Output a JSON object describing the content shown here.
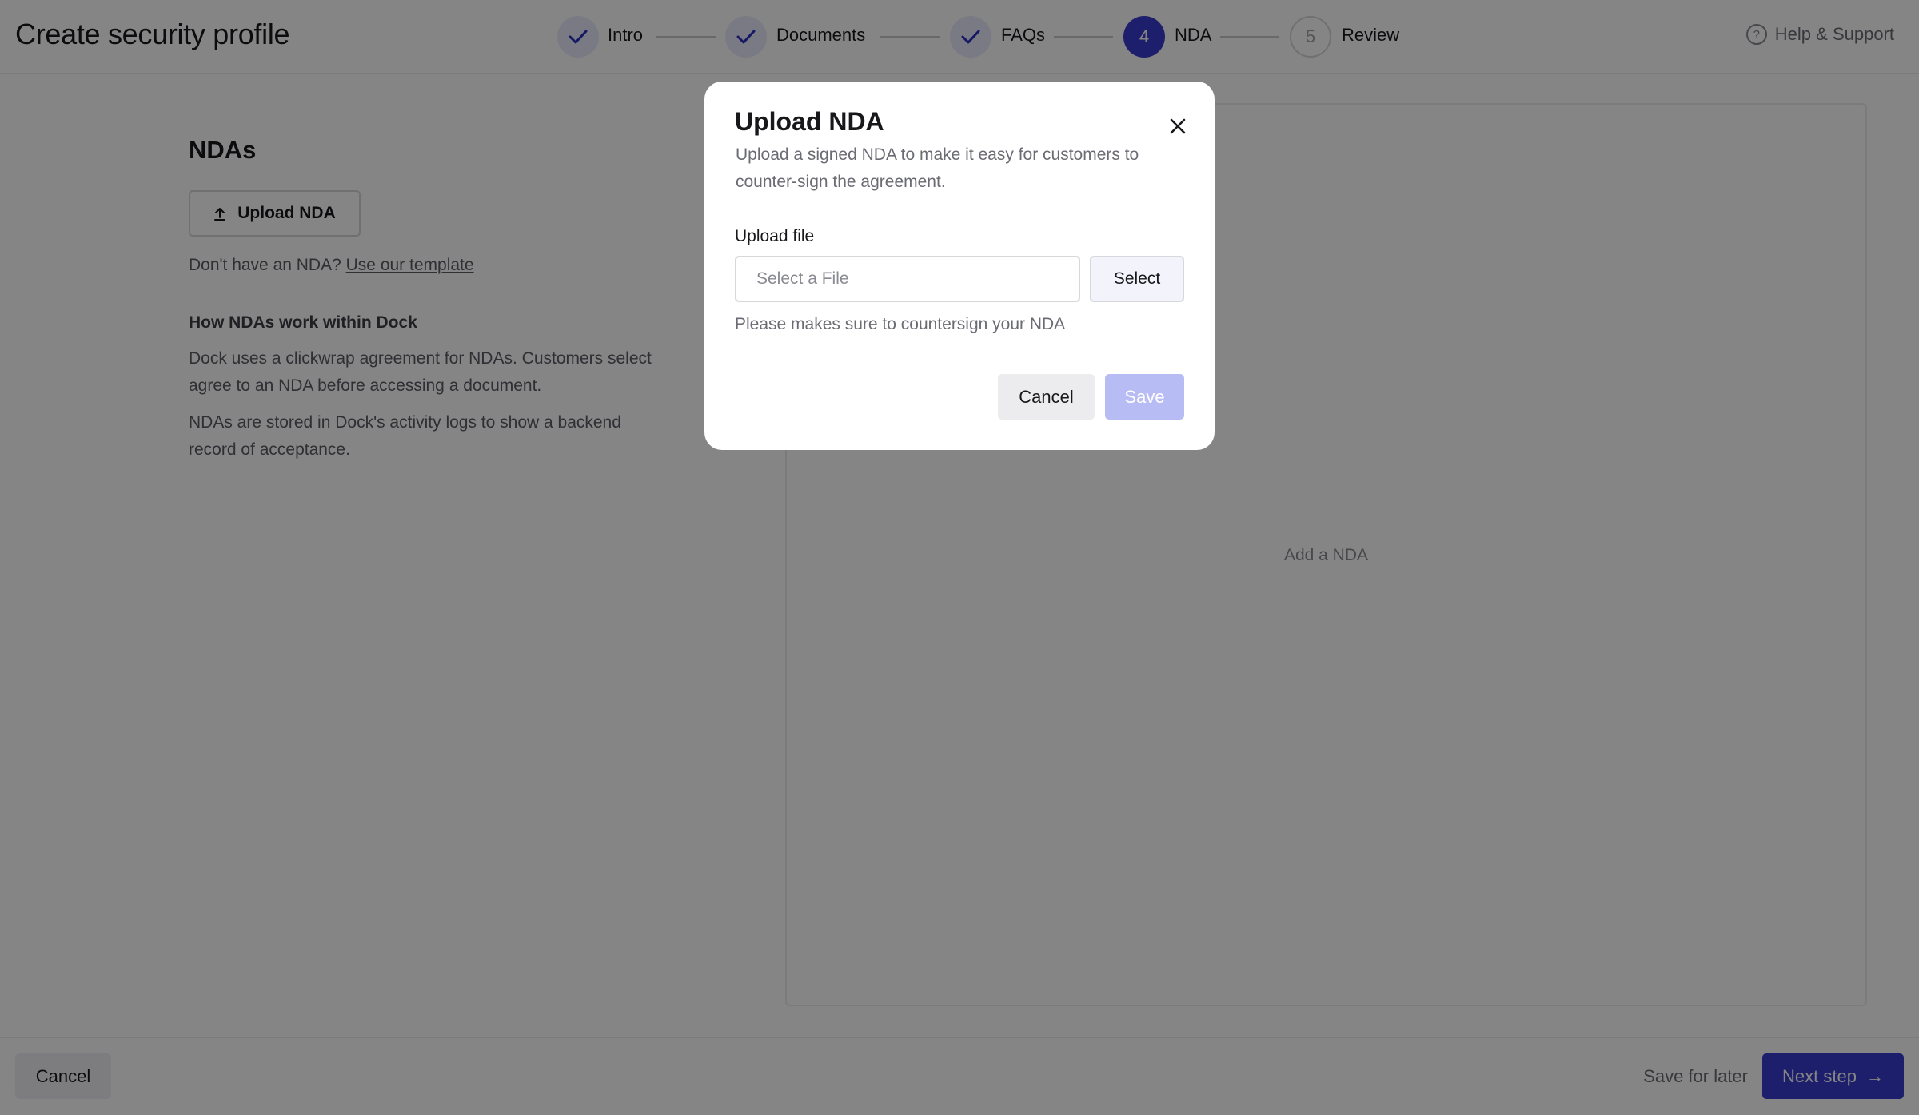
{
  "header": {
    "title": "Create security profile",
    "steps": [
      {
        "number": "",
        "label": "Intro",
        "state": "done"
      },
      {
        "number": "",
        "label": "Documents",
        "state": "done"
      },
      {
        "number": "",
        "label": "FAQs",
        "state": "done"
      },
      {
        "number": "4",
        "label": "NDA",
        "state": "current"
      },
      {
        "number": "5",
        "label": "Review",
        "state": "todo"
      }
    ],
    "help_label": "Help & Support",
    "help_glyph": "?"
  },
  "left": {
    "title": "NDAs",
    "upload_label": "Upload NDA",
    "no_nda_text": "Don't have an NDA?",
    "template_link": "Use our template",
    "how_title": "How NDAs work within Dock",
    "para1": "Dock uses a clickwrap agreement for NDAs. Customers select agree to an NDA before accessing a document.",
    "para2": "NDAs are stored in Dock's activity logs to show a backend record of acceptance."
  },
  "panel": {
    "empty_text": "Add a NDA"
  },
  "footer": {
    "cancel_label": "Cancel",
    "save_later_label": "Save for later",
    "next_label": "Next step",
    "next_arrow": "→"
  },
  "modal": {
    "title": "Upload NDA",
    "description": "Upload a signed NDA to make it easy for customers to counter-sign the agreement.",
    "field_label": "Upload file",
    "file_placeholder": "Select a File",
    "select_label": "Select",
    "hint": "Please makes sure to countersign your NDA",
    "cancel_label": "Cancel",
    "save_label": "Save"
  },
  "colors": {
    "accent": "#3a3dcf",
    "accent_light": "#e8eafc",
    "save_disabled": "#b8bcf4"
  }
}
